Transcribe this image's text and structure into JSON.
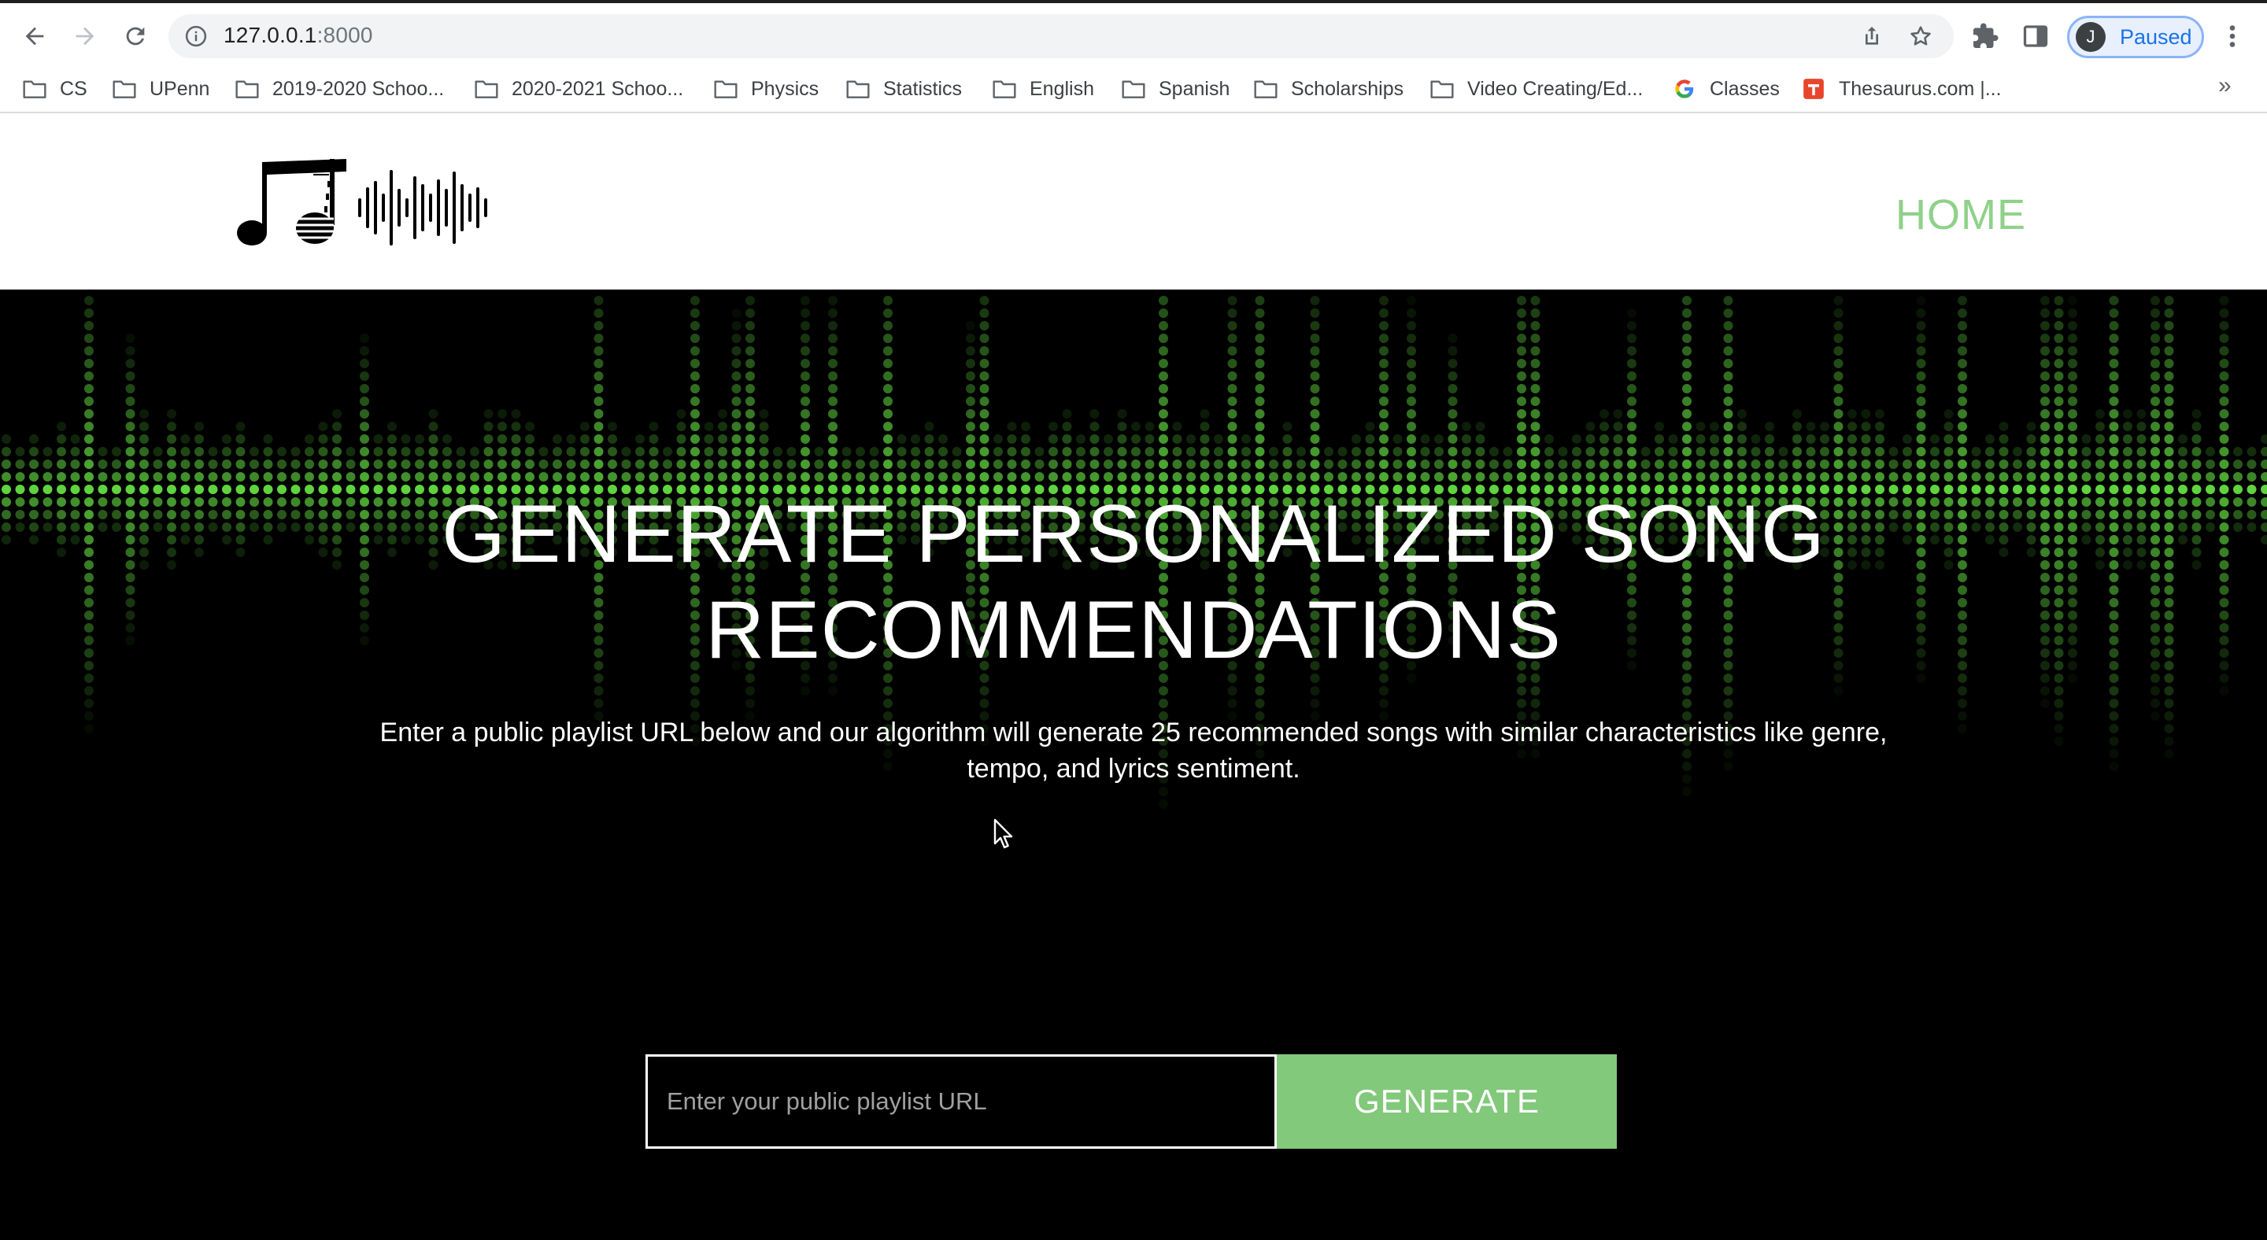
{
  "browser": {
    "url_host": "127.0.0.1",
    "url_port": ":8000",
    "profile_initial": "J",
    "profile_status": "Paused",
    "bookmarks": [
      {
        "label": "CS",
        "icon": "folder-icon"
      },
      {
        "label": "UPenn",
        "icon": "folder-icon"
      },
      {
        "label": "2019-2020 Schoo...",
        "icon": "folder-icon"
      },
      {
        "label": "2020-2021 Schoo...",
        "icon": "folder-icon"
      },
      {
        "label": "Physics",
        "icon": "folder-icon"
      },
      {
        "label": "Statistics",
        "icon": "folder-icon"
      },
      {
        "label": "English",
        "icon": "folder-icon"
      },
      {
        "label": "Spanish",
        "icon": "folder-icon"
      },
      {
        "label": "Scholarships",
        "icon": "folder-icon"
      },
      {
        "label": "Video Creating/Ed...",
        "icon": "folder-icon"
      },
      {
        "label": "Classes",
        "icon": "google-icon"
      },
      {
        "label": "Thesaurus.com |...",
        "icon": "thesaurus-icon"
      }
    ],
    "overflow_label": "»"
  },
  "header": {
    "nav_home": "HOME"
  },
  "hero": {
    "title": "GENERATE PERSONALIZED SONG RECOMMENDATIONS",
    "subtitle": "Enter a public playlist URL below and our algorithm will generate 25 recommended songs with similar characteristics like genre, tempo, and lyrics sentiment.",
    "input_placeholder": "Enter your public playlist URL",
    "input_value": "",
    "button_label": "GENERATE"
  },
  "colors": {
    "accent": "#82c97b",
    "nav_link": "#8fd18a",
    "hero_bg": "#000000",
    "wave_dots": "#5fd33f"
  }
}
